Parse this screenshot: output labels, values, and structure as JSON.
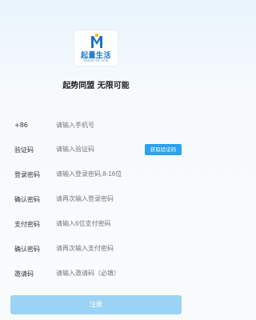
{
  "logo": {
    "title": "起量生活",
    "subtitle": "VALUE OF LIFE",
    "colors": {
      "blue": "#1a73c8",
      "yellow": "#f2c12e"
    }
  },
  "slogan": "起势同盟 无限可能",
  "form": {
    "rows": [
      {
        "label": "+86",
        "placeholder": "请输入手机号"
      },
      {
        "label": "验证码",
        "placeholder": "请输入验证码",
        "action": "获取验证码"
      },
      {
        "label": "登录密码",
        "placeholder": "请输入登录密码,8-16位"
      },
      {
        "label": "确认密码",
        "placeholder": "请再次输入登录密码"
      },
      {
        "label": "支付密码",
        "placeholder": "请输入6位支付密码"
      },
      {
        "label": "确认密码",
        "placeholder": "请再次输入支付密码"
      },
      {
        "label": "邀请码",
        "placeholder": "请输入邀请码（必填）"
      }
    ]
  },
  "register_label": "注册",
  "colors": {
    "accent": "#2aa2ed",
    "register_bg": "#9bd3f5"
  }
}
